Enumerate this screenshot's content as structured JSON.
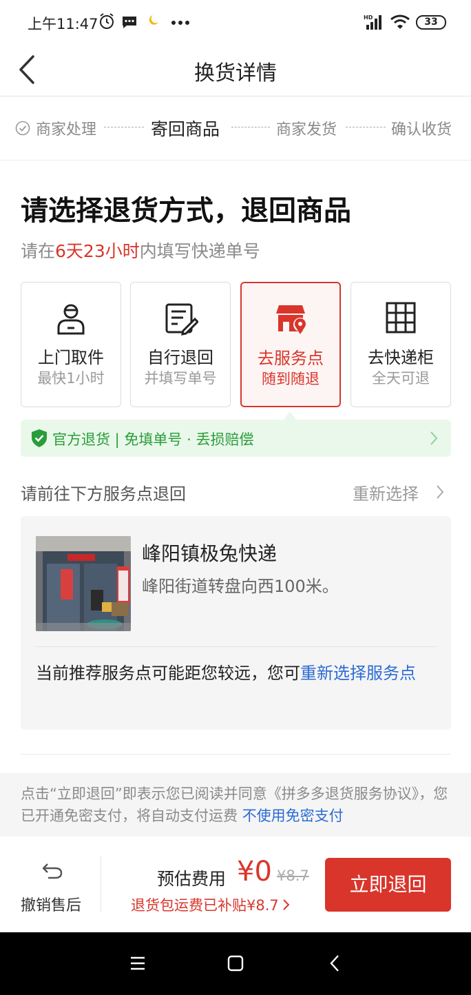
{
  "status_bar": {
    "time": "上午11:47",
    "battery": "33"
  },
  "nav": {
    "title": "换货详情"
  },
  "progress": {
    "steps": [
      "商家处理",
      "寄回商品",
      "商家发货",
      "确认收货"
    ],
    "active_index": 1
  },
  "headline": "请选择退货方式，退回商品",
  "deadline": {
    "prefix": "请在",
    "highlight": "6天23小时",
    "suffix": "内填写快递单号"
  },
  "methods": [
    {
      "title": "上门取件",
      "subtitle": "最快1小时",
      "icon": "courier-person-icon"
    },
    {
      "title": "自行退回",
      "subtitle": "并填写单号",
      "icon": "edit-document-icon"
    },
    {
      "title": "去服务点",
      "subtitle": "随到随退",
      "icon": "store-location-icon",
      "selected": true
    },
    {
      "title": "去快递柜",
      "subtitle": "全天可退",
      "icon": "locker-grid-icon"
    }
  ],
  "banner": {
    "text": "官方退货 | 免填单号 · 丢损赔偿"
  },
  "service_point": {
    "section_title": "请前往下方服务点退回",
    "reselect": "重新选择",
    "name": "峰阳镇极兔快递",
    "address": "峰阳街道转盘向西100米。",
    "note_prefix": "当前推荐服务点可能距您较远，您可",
    "note_link": "重新选择服务点"
  },
  "agreement": {
    "text": "点击“立即退回”即表示您已阅读并同意《拼多多退货服务协议》，您已开通免密支付，将自动支付运费",
    "link": "不使用免密支付"
  },
  "bottom": {
    "undo_label": "撤销售后",
    "fee_label": "预估费用",
    "fee_price": "¥0",
    "fee_original": "¥8.7",
    "subsidy": "退货包运费已补贴¥8.7",
    "submit_label": "立即退回"
  },
  "colors": {
    "accent": "#d9352b",
    "link": "#2b6bd4",
    "success": "#2a9d3a"
  }
}
